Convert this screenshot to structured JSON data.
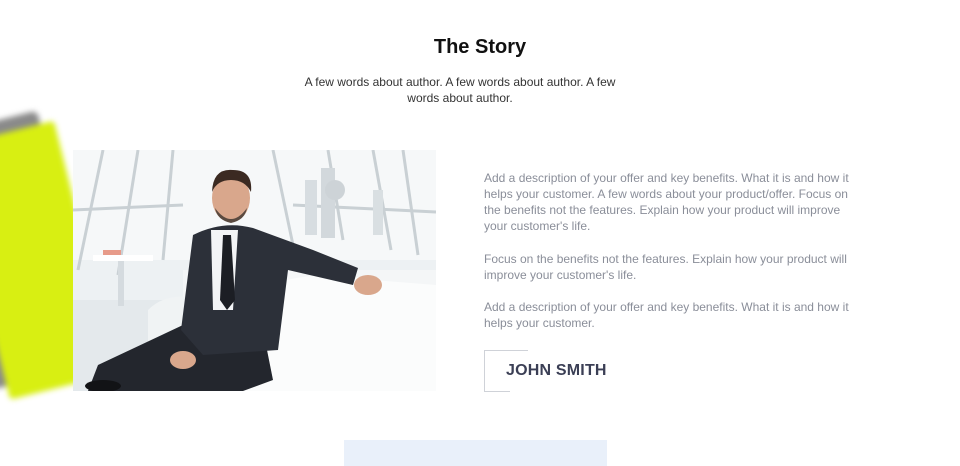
{
  "story": {
    "title": "The Story",
    "subtitle": "A few words about author. A few words about author. A few words about author."
  },
  "description": {
    "paragraph_1": "Add a description of your offer and key benefits. What it is and how it helps your customer. A few words about your product/offer. Focus on the benefits not the features. Explain how your product will improve your customer's life.",
    "paragraph_2": "Focus on the benefits not the features. Explain how your product will improve your customer's life.",
    "paragraph_3": "Add a description of your offer and key benefits. What it is and how it helps your customer."
  },
  "author": {
    "name": "JOHN SMITH"
  },
  "colors": {
    "title": "#111111",
    "body_text": "#8a8e99",
    "author_name": "#3b3f55",
    "decor_yellow": "#d8ef12",
    "next_section": "#e9f0fa"
  },
  "images": {
    "author_photo": "businessman-seated-on-white-sofa-photo",
    "decor": "blurred-yellow-card"
  }
}
